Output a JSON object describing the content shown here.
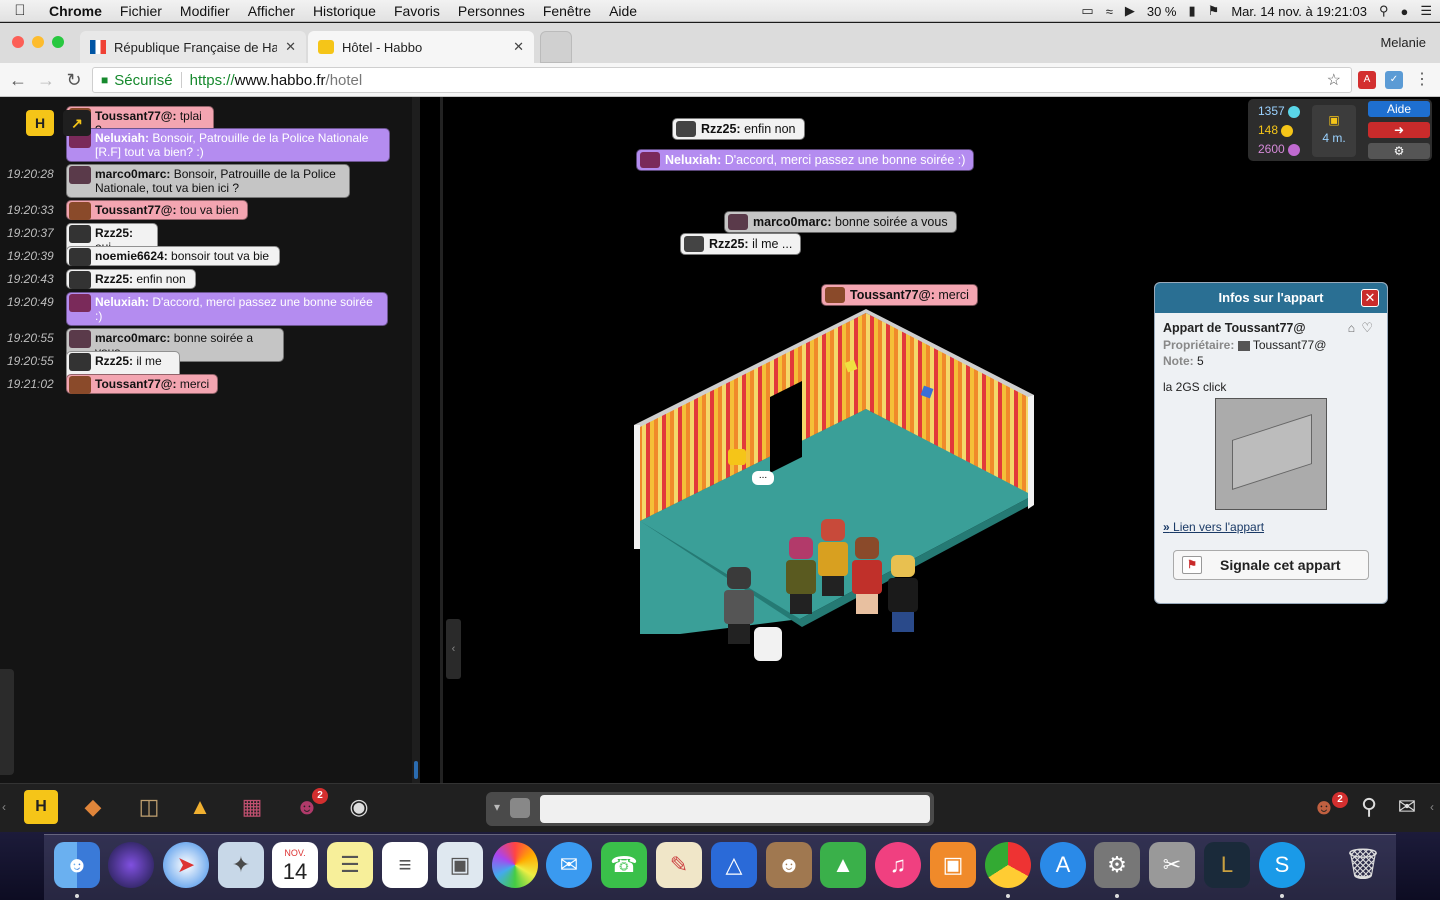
{
  "menubar": {
    "apple": "",
    "app": "Chrome",
    "items": [
      "Fichier",
      "Modifier",
      "Afficher",
      "Historique",
      "Favoris",
      "Personnes",
      "Fenêtre",
      "Aide"
    ],
    "battery": "30 %",
    "datetime": "Mar. 14 nov. à 19:21:03"
  },
  "tabs": [
    {
      "title": "République Française de Habb",
      "close": "✕"
    },
    {
      "title": "Hôtel - Habbo",
      "close": "✕"
    }
  ],
  "profile": "Melanie",
  "address": {
    "secure_label": "Sécurisé",
    "url_proto": "https://",
    "url_host": "www.habbo.fr",
    "url_path": "/hotel"
  },
  "chatlog": [
    {
      "time": "",
      "user": "Toussant77@:",
      "text": " tplai ?",
      "color": "pink"
    },
    {
      "time": "",
      "user": "Neluxiah:",
      "text": " Bonsoir, Patrouille de la Police Nationale [R.F] tout va bien? :)",
      "color": "purple"
    },
    {
      "time": "19:20:28",
      "user": "marco0marc:",
      "text": " Bonsoir, Patrouille de la Police Nationale, tout va bien ici ?",
      "color": "gray"
    },
    {
      "time": "19:20:33",
      "user": "Toussant77@:",
      "text": " tou va bien",
      "color": "pink"
    },
    {
      "time": "19:20:37",
      "user": "Rzz25:",
      "text": " oui",
      "color": "white"
    },
    {
      "time": "19:20:39",
      "user": "noemie6624:",
      "text": " bonsoir tout va bie",
      "color": "white"
    },
    {
      "time": "19:20:43",
      "user": "Rzz25:",
      "text": " enfin non",
      "color": "white"
    },
    {
      "time": "19:20:49",
      "user": "Neluxiah:",
      "text": " D'accord, merci passez une bonne soirée :)",
      "color": "purple"
    },
    {
      "time": "19:20:55",
      "user": "marco0marc:",
      "text": " bonne soirée a vous",
      "color": "gray"
    },
    {
      "time": "19:20:55",
      "user": "Rzz25:",
      "text": " il me ...",
      "color": "white"
    },
    {
      "time": "19:21:02",
      "user": "Toussant77@:",
      "text": " merci",
      "color": "pink"
    }
  ],
  "room_bubbles": [
    {
      "user": "Rzz25:",
      "text": " enfin non",
      "color": "white"
    },
    {
      "user": "Neluxiah:",
      "text": " D'accord, merci passez une bonne soirée :)",
      "color": "purple"
    },
    {
      "user": "marco0marc:",
      "text": " bonne soirée a vous",
      "color": "gray"
    },
    {
      "user": "Rzz25:",
      "text": " il me ...",
      "color": "white"
    },
    {
      "user": "Toussant77@:",
      "text": " merci",
      "color": "pink"
    }
  ],
  "purse": {
    "diamonds": "1357",
    "credits": "148",
    "duckets": "2600",
    "hc_time": "4 m.",
    "help": "Aide"
  },
  "roominfo": {
    "title": "Infos sur l'appart",
    "name": "Appart de Toussant77@",
    "owner_label": "Propriétaire:",
    "owner": "Toussant77@",
    "rating_label": "Note:",
    "rating": "5",
    "description": "la 2GS click",
    "link": "Lien vers l'appart",
    "report": "Signale cet appart"
  },
  "toolbar": {
    "friends_badge": "2",
    "requests_badge": "2"
  },
  "dock": {
    "calendar_month": "NOV.",
    "calendar_day": "14"
  },
  "colors": {
    "pink": "#f3a5b1",
    "purple": "#b48cf0",
    "gray": "#c5c5c5",
    "white": "#f2f2f2",
    "info_header": "#2a6f93"
  }
}
